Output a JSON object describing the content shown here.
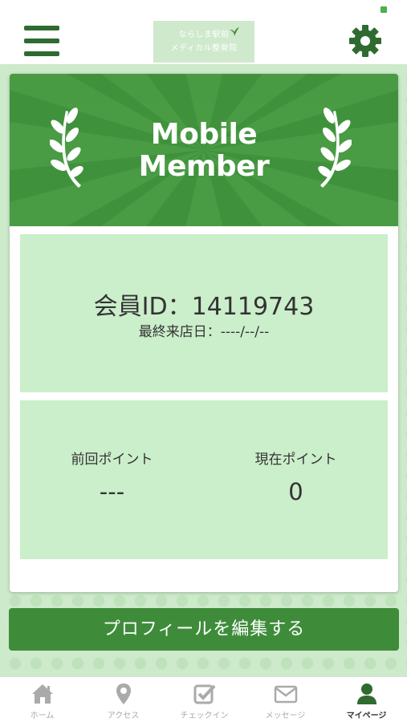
{
  "header": {
    "logo_line1": "ならしま駅前",
    "logo_line2": "メディカル整骨院"
  },
  "banner": {
    "title_line1": "Mobile",
    "title_line2": "Member"
  },
  "member": {
    "id_text": "会員ID：14119743",
    "last_visit_text": "最終来店日：----/--/--"
  },
  "points": {
    "previous_label": "前回ポイント",
    "previous_value": "---",
    "current_label": "現在ポイント",
    "current_value": "0"
  },
  "edit_profile_label": "プロフィールを編集する",
  "tabs": [
    {
      "label": "ホーム",
      "icon": "home-icon"
    },
    {
      "label": "アクセス",
      "icon": "map-pin-icon"
    },
    {
      "label": "チェックイン",
      "icon": "checkin-icon"
    },
    {
      "label": "メッセージ",
      "icon": "mail-icon"
    },
    {
      "label": "マイページ",
      "icon": "user-icon"
    }
  ],
  "colors": {
    "brand_green": "#3f923b",
    "panel_green": "#cbeecb",
    "background_green": "#cdeacb",
    "active_tab": "#2f6b2f",
    "inactive_tab": "#aaaaaa"
  }
}
